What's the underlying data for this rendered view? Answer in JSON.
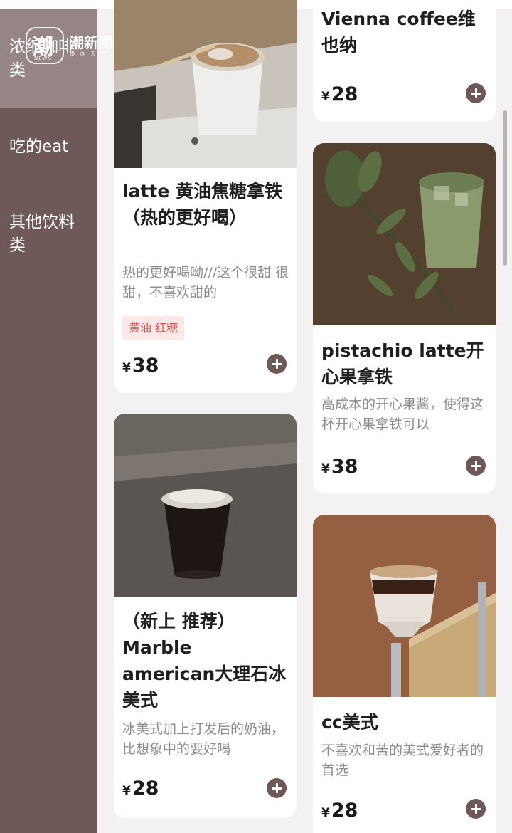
{
  "watermark": {
    "mark": "潮",
    "mark_sub": "NEWS",
    "name": "潮新闻",
    "sub": "潮 闻 天 下"
  },
  "sidebar": {
    "items": [
      {
        "label": "浓缩咖啡类",
        "active": true
      },
      {
        "label": "吃的eat",
        "active": false
      },
      {
        "label": "其他饮料类",
        "active": false
      }
    ]
  },
  "products_left": [
    {
      "title": "latte 黄油焦糖拿铁（热的更好喝）",
      "desc": "热的更好喝呦///这个很甜 很甜，不喜欢甜的",
      "tag": "黄油 红糖",
      "currency": "¥",
      "price": "38"
    },
    {
      "title": "（新上 推荐）Marble american大理石冰美式",
      "desc": "冰美式加上打发后的奶油，比想象中的要好喝",
      "currency": "¥",
      "price": "28"
    }
  ],
  "products_right": [
    {
      "title": "Vienna coffee维也纳",
      "currency": "¥",
      "price": "28"
    },
    {
      "title": "pistachio latte开心果拿铁",
      "desc": "高成本的开心果酱，使得这杯开心果拿铁可以",
      "currency": "¥",
      "price": "38"
    },
    {
      "title": "cc美式",
      "desc": "不喜欢和苦的美式爱好者的首选",
      "currency": "¥",
      "price": "28"
    }
  ],
  "colors": {
    "sidebar": "#6e5858",
    "sidebar_active": "#958585",
    "accent": "#6e5858",
    "tag_bg": "#fde8e8",
    "tag_text": "#d9534f"
  }
}
